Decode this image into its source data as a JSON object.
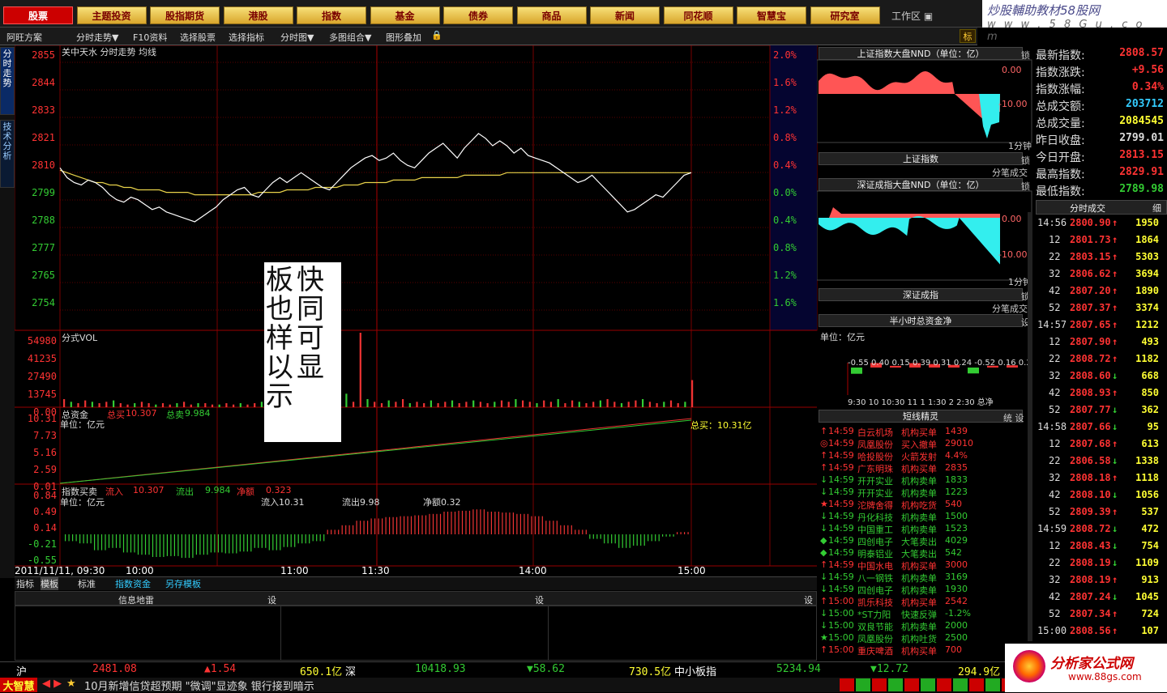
{
  "nav": {
    "items": [
      "股票",
      "主题投资",
      "股指期货",
      "港股",
      "指数",
      "基金",
      "债券",
      "商品",
      "新闻",
      "同花顺",
      "智慧宝",
      "研究室"
    ],
    "active": 0,
    "workspace": "工作区 ▣"
  },
  "brand": {
    "line1": "炒股輔助教材58股网",
    "line2": "w w w . 5 8 G u . c o m"
  },
  "toolbar": {
    "items": [
      "阿旺方案",
      "分时走势▼",
      "F10资料",
      "选择股票",
      "选择指标",
      "分时图▼",
      "多图组合▼",
      "图形叠加"
    ],
    "right_btn": "标"
  },
  "left_tabs": [
    "分时走势",
    "技术分析"
  ],
  "chart": {
    "header": "关中天水  分时走势  均线",
    "y_left": [
      "2855",
      "2844",
      "2833",
      "2821",
      "2810",
      "2799",
      "2788",
      "2777",
      "2765",
      "2754"
    ],
    "y_right": [
      "2.0%",
      "1.6%",
      "1.2%",
      "0.8%",
      "0.4%",
      "0.0%",
      "0.4%",
      "0.8%",
      "1.2%",
      "1.6%"
    ],
    "vol_title": "分式VOL",
    "vol_ticks": [
      "54980",
      "41235",
      "27490",
      "13745",
      "0.00"
    ],
    "fund_title": "总资金",
    "fund_total_label": "总买",
    "fund_total": "10.307",
    "fund_sell_label": "总卖",
    "fund_sell": "9.984",
    "fund_unit": "单位：亿元",
    "fund_ticks": [
      "10.31",
      "7.73",
      "5.16",
      "2.59",
      "0.01"
    ],
    "fund_end": "总买：10.31亿",
    "idx_title": "指数买卖",
    "idx_in_label": "流入",
    "idx_in": "10.307",
    "idx_out_label": "流出",
    "idx_out": "9.984",
    "idx_net_label": "净额",
    "idx_net": "0.323",
    "idx_unit": "单位：亿元",
    "idx_in2": "流入10.31",
    "idx_out2": "流出9.98",
    "idx_net2": "净额0.32",
    "idx_ticks": [
      "0.84",
      "0.49",
      "0.14",
      "-0.21",
      "-0.55"
    ],
    "x_labels": [
      "2011/11/11, 09:30",
      "10:00",
      "11:00",
      "11:30",
      "14:00",
      "15:00"
    ],
    "price_series": [
      2812,
      2808,
      2806,
      2805,
      2807,
      2806,
      2804,
      2801,
      2799,
      2798,
      2800,
      2799,
      2797,
      2795,
      2796,
      2794,
      2793,
      2792,
      2791,
      2790,
      2792,
      2794,
      2796,
      2799,
      2801,
      2803,
      2804,
      2801,
      2800,
      2803,
      2806,
      2808,
      2806,
      2808,
      2810,
      2808,
      2806,
      2804,
      2803,
      2806,
      2809,
      2812,
      2814,
      2816,
      2817,
      2815,
      2816,
      2818,
      2815,
      2813,
      2812,
      2815,
      2818,
      2820,
      2822,
      2819,
      2816,
      2820,
      2823,
      2826,
      2824,
      2821,
      2823,
      2821,
      2818,
      2820,
      2817,
      2816,
      2815,
      2814,
      2812,
      2810,
      2808,
      2806,
      2807,
      2809,
      2806,
      2803,
      2800,
      2797,
      2794,
      2795,
      2797,
      2799,
      2801,
      2800,
      2803,
      2806,
      2809,
      2810
    ],
    "avg_series": [
      2811,
      2810,
      2809,
      2808,
      2807,
      2806,
      2806,
      2805,
      2805,
      2804,
      2804,
      2803,
      2803,
      2803,
      2803,
      2802,
      2802,
      2802,
      2802,
      2801,
      2801,
      2801,
      2801,
      2801,
      2801,
      2801,
      2801,
      2801,
      2802,
      2802,
      2802,
      2802,
      2803,
      2803,
      2803,
      2803,
      2804,
      2804,
      2804,
      2804,
      2805,
      2805,
      2805,
      2806,
      2806,
      2806,
      2806,
      2807,
      2807,
      2807,
      2807,
      2808,
      2808,
      2808,
      2808,
      2808,
      2808,
      2809,
      2809,
      2809,
      2809,
      2809,
      2809,
      2810,
      2810,
      2810,
      2810,
      2810,
      2810,
      2810,
      2810,
      2810,
      2810,
      2810,
      2810,
      2810,
      2810,
      2810,
      2810,
      2810,
      2810,
      2810,
      2810,
      2810,
      2810,
      2810,
      2810,
      2810,
      2810,
      2810
    ],
    "ylim": [
      2749,
      2857
    ],
    "fund_buy": [
      0.01,
      10.31
    ],
    "fund_sell_curve": [
      0.01,
      9.98
    ],
    "idx_series": [
      -0.15,
      -0.2,
      -0.35,
      -0.3,
      -0.4,
      -0.45,
      -0.5,
      -0.48,
      -0.52,
      -0.45,
      -0.4,
      -0.42,
      -0.38,
      -0.3,
      -0.35,
      -0.28,
      -0.2,
      -0.15,
      0.1,
      0.2,
      0.3,
      0.35,
      0.38,
      0.4,
      0.42,
      0.45,
      0.5,
      0.52,
      0.55,
      0.5,
      0.48,
      0.45,
      0.4,
      0.3,
      0.2,
      0.1,
      -0.1,
      -0.2,
      -0.3,
      -0.25,
      -0.15,
      -0.05,
      0.05
    ],
    "vol_series": [
      6,
      4,
      3,
      5,
      4,
      3,
      4,
      5,
      3,
      2,
      3,
      4,
      3,
      2,
      3,
      2,
      3,
      4,
      2,
      3,
      3,
      2,
      2,
      3,
      2,
      3,
      2,
      3,
      4,
      3,
      5,
      4,
      6,
      8,
      10,
      12,
      30,
      8,
      5,
      6,
      10,
      4,
      55,
      6,
      4,
      3,
      5,
      4,
      6,
      3,
      4,
      3,
      5,
      3,
      4,
      5,
      3,
      4,
      5,
      4,
      3,
      4,
      5,
      4,
      6,
      5,
      4,
      3,
      5,
      4,
      6,
      3,
      5,
      4,
      3,
      4,
      5,
      6,
      4,
      3,
      4,
      5,
      6,
      4,
      3,
      4,
      5,
      3,
      4,
      20
    ]
  },
  "overlay": {
    "col1": "板也样以示",
    "col2": "快同可显"
  },
  "right": {
    "p1_title": "上证指数大盘NND（单位：亿）",
    "p1_lock": "锁",
    "p1_tick_top": "0.00",
    "p1_tick_bot": "-10.00",
    "p1_foot": "1分钟",
    "p2_title": "上证指数",
    "p2_btn": "锁",
    "p2_foot": "分笔成交",
    "p3_title": "深证成指大盘NND（单位：亿）",
    "p3_lock": "锁",
    "p3_tick_top": "0.00",
    "p3_tick_bot": "-10.00",
    "p3_foot": "1分钟",
    "p4_title": "深证成指",
    "p4_btn": "锁",
    "p4_foot": "分笔成交",
    "p5_title": "半小时总资金净",
    "p5_btn": "设",
    "p5_unit": "单位：亿元",
    "p5_values": "-0.55  0.40  0.15  0.39  0.31  0.24  -0.52  0.16  0.2",
    "p5_xlabels": "9:30 10    10:30 11    1   1:30  2    2:30 总净",
    "p5_bars": [
      -0.55,
      0.4,
      0.15,
      0.39,
      0.31,
      0.24,
      -0.52,
      0.16,
      0.2
    ],
    "p6_title": "短线精灵",
    "p6_btns": "统  设",
    "events": [
      [
        "↑",
        "14:59",
        "白云机场",
        "机构买单",
        "1439",
        "#f33"
      ],
      [
        "◎",
        "14:59",
        "凤凰股份",
        "买入撤单",
        "29010",
        "#f33"
      ],
      [
        "↑",
        "14:59",
        "哈投股份",
        "火箭发射",
        "4.4%",
        "#f33"
      ],
      [
        "↑",
        "14:59",
        "广东明珠",
        "机构买单",
        "2835",
        "#f33"
      ],
      [
        "↓",
        "14:59",
        "开开实业",
        "机构卖单",
        "1833",
        "#3c3"
      ],
      [
        "↓",
        "14:59",
        "开开实业",
        "机构卖单",
        "1223",
        "#3c3"
      ],
      [
        "★",
        "14:59",
        "沱牌舍得",
        "机构吃货",
        "540",
        "#f33"
      ],
      [
        "↓",
        "14:59",
        "丹化科技",
        "机构卖单",
        "1500",
        "#3c3"
      ],
      [
        "↓",
        "14:59",
        "中国重工",
        "机构卖单",
        "1523",
        "#3c3"
      ],
      [
        "◆",
        "14:59",
        "四创电子",
        "大笔卖出",
        "4029",
        "#3c3"
      ],
      [
        "◆",
        "14:59",
        "明泰铝业",
        "大笔卖出",
        "542",
        "#3c3"
      ],
      [
        "↑",
        "14:59",
        "中国水电",
        "机构买单",
        "3000",
        "#f33"
      ],
      [
        "↓",
        "14:59",
        "八一钢铁",
        "机构卖单",
        "3169",
        "#3c3"
      ],
      [
        "↓",
        "14:59",
        "四创电子",
        "机构卖单",
        "1930",
        "#3c3"
      ],
      [
        "↑",
        "15:00",
        "凯乐科技",
        "机构买单",
        "2542",
        "#f33"
      ],
      [
        "↓",
        "15:00",
        "*ST力阳",
        "快速反弹",
        "-1.2%",
        "#3c3"
      ],
      [
        "↓",
        "15:00",
        "双良节能",
        "机构卖单",
        "2000",
        "#3c3"
      ],
      [
        "★",
        "15:00",
        "凤凰股份",
        "机构吐货",
        "2500",
        "#3c3"
      ],
      [
        "↑",
        "15:00",
        "重庆啤酒",
        "机构买单",
        "700",
        "#f33"
      ]
    ]
  },
  "stats": [
    [
      "最新指数:",
      "2808.57",
      "#f33"
    ],
    [
      "指数涨跌:",
      "+9.56",
      "#f33"
    ],
    [
      "指数涨幅:",
      "0.34%",
      "#f33"
    ],
    [
      "总成交额:",
      "203712",
      "#3cf"
    ],
    [
      "总成交量:",
      "2084545",
      "#ff3"
    ],
    [
      "昨日收盘:",
      "2799.01",
      "#ddd"
    ],
    [
      "今日开盘:",
      "2813.15",
      "#f33"
    ],
    [
      "最高指数:",
      "2829.91",
      "#f33"
    ],
    [
      "最低指数:",
      "2789.98",
      "#3c3"
    ]
  ],
  "ticks_title": "分时成交",
  "ticks_btn": "细",
  "ticks": [
    [
      "14:56",
      "2800.90",
      "↑",
      "1950",
      "#ff3"
    ],
    [
      "12",
      "2801.73",
      "↑",
      "1864",
      "#ff3"
    ],
    [
      "22",
      "2803.15",
      "↑",
      "5303",
      "#ff3"
    ],
    [
      "32",
      "2806.62",
      "↑",
      "3694",
      "#ff3"
    ],
    [
      "42",
      "2807.20",
      "↑",
      "1890",
      "#ff3"
    ],
    [
      "52",
      "2807.37",
      "↑",
      "3374",
      "#ff3"
    ],
    [
      "14:57",
      "2807.65",
      "↑",
      "1212",
      "#ff3"
    ],
    [
      "12",
      "2807.90",
      "↑",
      "493",
      "#ff3"
    ],
    [
      "22",
      "2808.72",
      "↑",
      "1182",
      "#ff3"
    ],
    [
      "32",
      "2808.60",
      "↓",
      "668",
      "#ff3"
    ],
    [
      "42",
      "2808.93",
      "↑",
      "850",
      "#ff3"
    ],
    [
      "52",
      "2807.77",
      "↓",
      "362",
      "#ff3"
    ],
    [
      "14:58",
      "2807.66",
      "↓",
      "95",
      "#ff3"
    ],
    [
      "12",
      "2807.68",
      "↑",
      "613",
      "#ff3"
    ],
    [
      "22",
      "2806.58",
      "↓",
      "1338",
      "#ff3"
    ],
    [
      "32",
      "2808.18",
      "↑",
      "1118",
      "#ff3"
    ],
    [
      "42",
      "2808.10",
      "↓",
      "1056",
      "#ff3"
    ],
    [
      "52",
      "2809.39",
      "↑",
      "537",
      "#ff3"
    ],
    [
      "14:59",
      "2808.72",
      "↓",
      "472",
      "#ff3"
    ],
    [
      "12",
      "2808.43",
      "↓",
      "754",
      "#ff3"
    ],
    [
      "22",
      "2808.19",
      "↓",
      "1109",
      "#ff3"
    ],
    [
      "32",
      "2808.19",
      "↑",
      "913",
      "#ff3"
    ],
    [
      "42",
      "2807.24",
      "↓",
      "1045",
      "#ff3"
    ],
    [
      "52",
      "2807.34",
      "↑",
      "724",
      "#ff3"
    ],
    [
      "15:00",
      "2808.56",
      "↑",
      "107",
      "#ff3"
    ]
  ],
  "bottom_tabs": [
    "指标",
    "模板",
    "标准",
    "指数资金",
    "另存模板"
  ],
  "info_panel": {
    "title": "信息地雷",
    "btn": "设"
  },
  "status": {
    "sh_label": "沪",
    "sh_idx": "2481.08",
    "sh_chg": "▲1.54",
    "sh_amt": "650.1亿",
    "sz_label": "深",
    "sz_idx": "10418.93",
    "sz_chg": "▼58.62",
    "sz_amt": "730.5亿",
    "sme_label": "中小板指",
    "sme_idx": "5234.94",
    "sme_chg": "▼12.72",
    "sme_amt": "294.9亿"
  },
  "ticker": {
    "badge": "大智慧",
    "text": "10月新增信贷超预期 \"微调\"显迹象 银行接到暗示"
  },
  "logo": {
    "line1": "分析家公式网",
    "line2": "www.88gs.com"
  },
  "colors": {
    "up": "#ff3333",
    "down": "#33cc33",
    "grid": "#8a0000",
    "accent": "#ffcc33"
  }
}
